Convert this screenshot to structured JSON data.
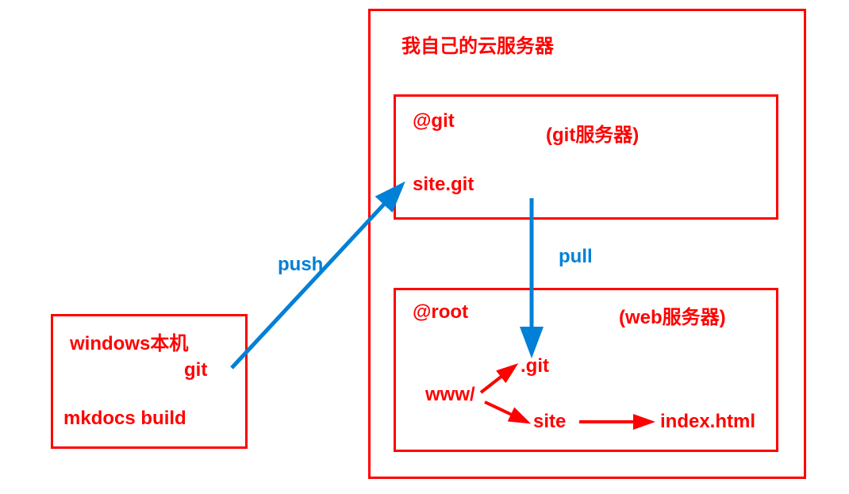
{
  "local_box": {
    "title": "windows本机",
    "git": "git",
    "build": "mkdocs build"
  },
  "cloud_box": {
    "title": "我自己的云服务器"
  },
  "git_server_box": {
    "user": "@git",
    "label": "(git服务器)",
    "repo": "site.git"
  },
  "web_server_box": {
    "user": "@root",
    "label": "(web服务器)",
    "git_dir": ".git",
    "www": "www/",
    "site_dir": "site",
    "index": "index.html"
  },
  "arrows": {
    "push": "push",
    "pull": "pull"
  }
}
